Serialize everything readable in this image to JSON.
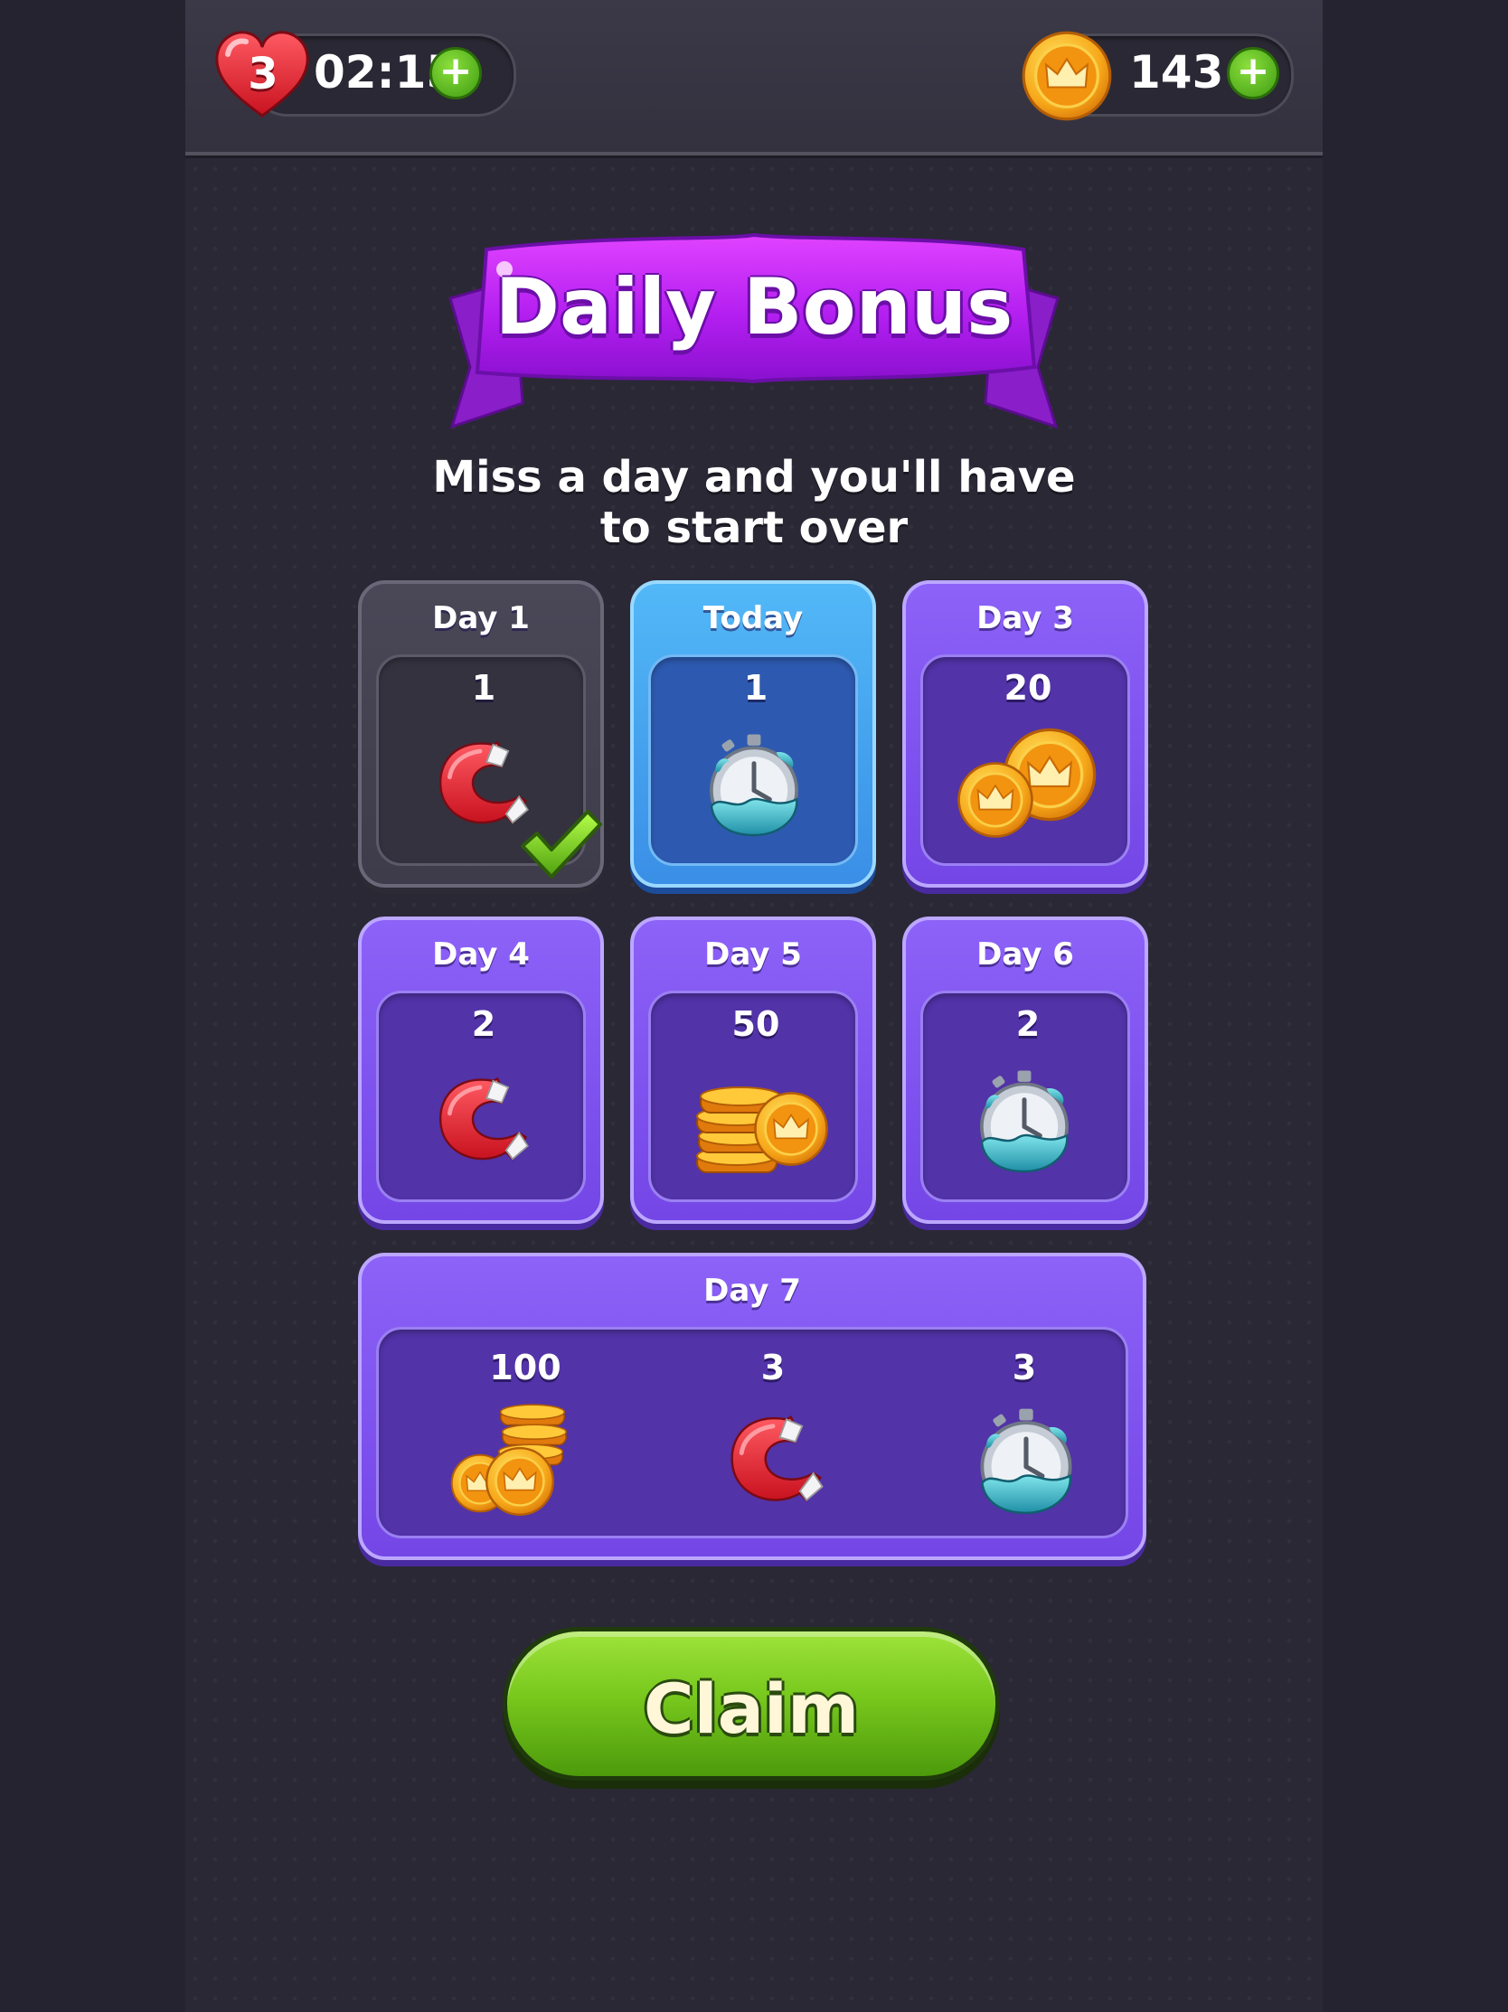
{
  "hud": {
    "lives": "3",
    "timer": "02:15",
    "coins": "143",
    "plus_symbol": "+"
  },
  "banner": {
    "title": "Daily Bonus"
  },
  "subtitle": {
    "line1": "Miss a day and you'll have",
    "line2": "to start over"
  },
  "days": [
    {
      "label": "Day 1",
      "state": "claimed",
      "rewards": [
        {
          "count": "1",
          "icon": "magnet-icon"
        }
      ]
    },
    {
      "label": "Today",
      "state": "current",
      "rewards": [
        {
          "count": "1",
          "icon": "stopwatch-icon"
        }
      ]
    },
    {
      "label": "Day 3",
      "state": "locked",
      "rewards": [
        {
          "count": "20",
          "icon": "coins-icon"
        }
      ]
    },
    {
      "label": "Day 4",
      "state": "locked",
      "rewards": [
        {
          "count": "2",
          "icon": "magnet-icon"
        }
      ]
    },
    {
      "label": "Day 5",
      "state": "locked",
      "rewards": [
        {
          "count": "50",
          "icon": "coin-stack-icon"
        }
      ]
    },
    {
      "label": "Day 6",
      "state": "locked",
      "rewards": [
        {
          "count": "2",
          "icon": "stopwatch-icon"
        }
      ]
    },
    {
      "label": "Day 7",
      "state": "locked",
      "rewards": [
        {
          "count": "100",
          "icon": "coin-pile-icon"
        },
        {
          "count": "3",
          "icon": "magnet-icon"
        },
        {
          "count": "3",
          "icon": "stopwatch-icon"
        }
      ]
    }
  ],
  "claim": {
    "label": "Claim"
  },
  "colors": {
    "background": "#25232f",
    "card_purple": "#7f55f0",
    "card_today": "#4aa8f2",
    "card_claimed": "#44424f",
    "claim_green": "#78c81d",
    "banner_purple": "#b21ff0"
  }
}
